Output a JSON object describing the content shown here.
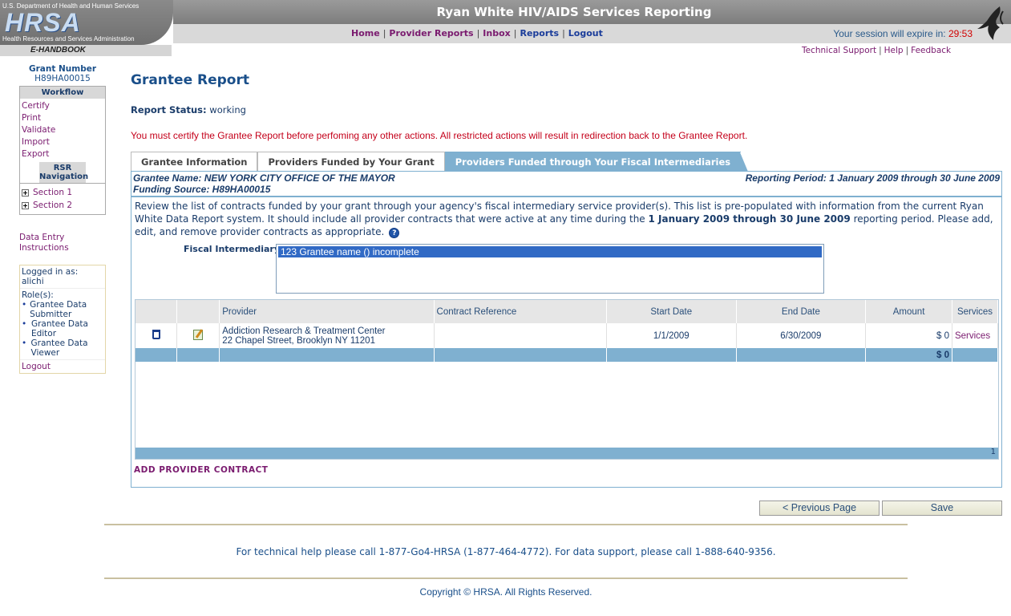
{
  "header": {
    "agency": "U.S. Department of Health and Human Services",
    "logo": "HRSA",
    "agency_sub": "Health Resources and Services Administration",
    "app_title": "Ryan White HIV/AIDS Services Reporting",
    "nav": [
      "Home",
      "Provider Reports",
      "Inbox",
      "Reports",
      "Logout"
    ],
    "session_label": "Your session will expire in:",
    "session_time": "29:53",
    "ehandbook": "E-HANDBOOK",
    "top_links": [
      "Technical Support",
      "Help",
      "Feedback"
    ]
  },
  "sidebar": {
    "grant_label": "Grant Number",
    "grant_number": "H89HA00015",
    "workflow_title": "Workflow",
    "workflow_items": [
      "Certify",
      "Print",
      "Validate",
      "Import",
      "Export"
    ],
    "rsr_title": "RSR Navigation",
    "sections": [
      "Section 1",
      "Section 2"
    ],
    "data_entry": "Data Entry Instructions",
    "logged_in_label": "Logged in as:",
    "username": "alichi",
    "roles_label": "Role(s):",
    "roles": [
      "Grantee Data Submitter",
      "Grantee Data Editor",
      "Grantee Data Viewer"
    ],
    "logout": "Logout"
  },
  "main": {
    "title": "Grantee Report",
    "status_label": "Report Status:",
    "status_value": "working",
    "warning": "You must certify the Grantee Report before perfoming any other actions. All restricted actions will result in redirection back to the Grantee Report.",
    "tabs": [
      "Grantee Information",
      "Providers Funded by Your Grant",
      "Providers Funded through Your Fiscal Intermediaries"
    ],
    "grantee_name": "Grantee Name: NEW YORK CITY OFFICE OF THE MAYOR",
    "funding_source": "Funding Source: H89HA00015",
    "reporting_period": "Reporting Period: 1 January 2009 through 30 June 2009",
    "review_text_1": "Review the list of contracts funded by your grant through your agency's fiscal intermediary service provider(s). This list is pre-populated with information from the current Ryan White Data Report system. It should include all provider contracts that were active at any time during the",
    "review_period": "1 January 2009 through 30 June 2009",
    "review_text_2": "reporting period. Please add, edit, and remove provider contracts as appropriate.",
    "fi_label": "Fiscal Intermediary:",
    "fi_selected": "123 Grantee name () incomplete",
    "columns": [
      "",
      "",
      "Provider",
      "Contract Reference",
      "Start Date",
      "End Date",
      "Amount",
      "Services"
    ],
    "row": {
      "provider_name": "Addiction Research & Treatment Center",
      "provider_address": "22 Chapel Street, Brooklyn NY 11201",
      "contract_ref": "",
      "start": "1/1/2009",
      "end": "6/30/2009",
      "amount": "$ 0",
      "services": "Services"
    },
    "total": "$ 0",
    "page_num": "1",
    "add_contract": "ADD PROVIDER CONTRACT",
    "prev_button": "< Previous Page",
    "save_button": "Save"
  },
  "footer": {
    "help": "For technical help please call 1-877-Go4-HRSA (1-877-464-4772). For data support, please call 1-888-640-9356.",
    "copyright": "Copyright © HRSA. All Rights Reserved."
  }
}
